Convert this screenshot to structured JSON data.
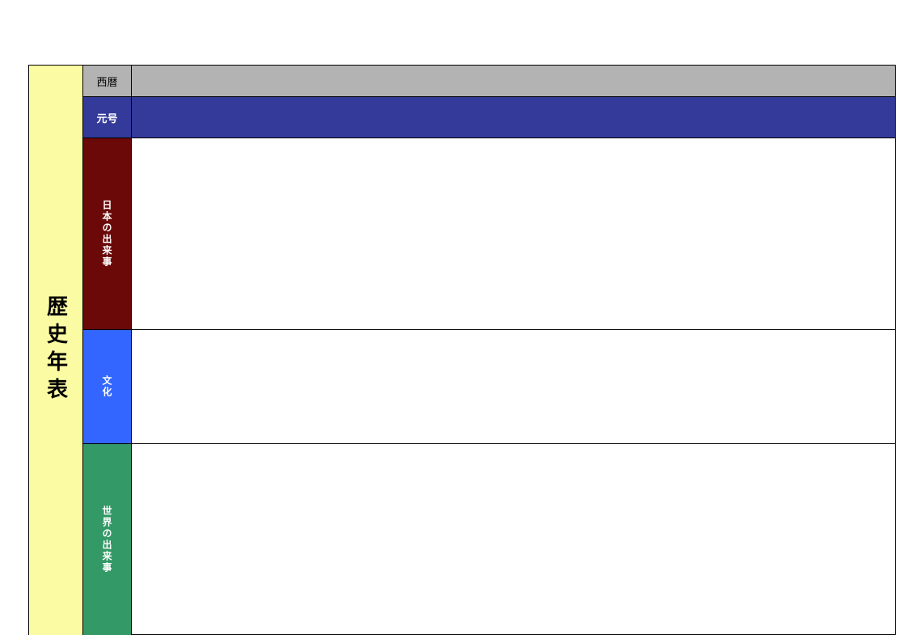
{
  "title": "歴史年表",
  "rows": {
    "seireki": {
      "label": "西暦"
    },
    "gengo": {
      "label": "元号"
    },
    "japan": {
      "label": "日本の出来事"
    },
    "culture": {
      "label": "文化"
    },
    "world": {
      "label": "世界の出来事"
    }
  }
}
